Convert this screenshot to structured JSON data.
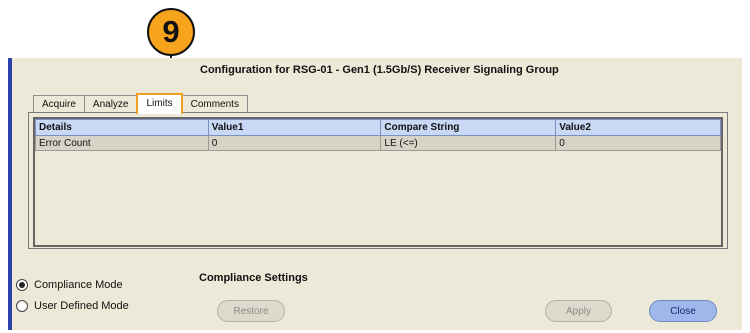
{
  "callout": {
    "number": "9"
  },
  "window": {
    "title": "Configuration for RSG-01 - Gen1 (1.5Gb/S) Receiver Signaling Group"
  },
  "tabs": [
    {
      "label": "Acquire",
      "active": false
    },
    {
      "label": "Analyze",
      "active": false
    },
    {
      "label": "Limits",
      "active": true
    },
    {
      "label": "Comments",
      "active": false
    }
  ],
  "table": {
    "columns": [
      "Details",
      "Value1",
      "Compare String",
      "Value2"
    ],
    "rows": [
      [
        "Error Count",
        "0",
        "LE (<=)",
        "0"
      ]
    ]
  },
  "modes": {
    "compliance": {
      "label": "Compliance Mode",
      "selected": true
    },
    "user_defined": {
      "label": "User Defined Mode",
      "selected": false
    }
  },
  "settings": {
    "title": "Compliance Settings"
  },
  "buttons": {
    "restore": "Restore",
    "apply": "Apply",
    "close": "Close"
  },
  "colors": {
    "accent": "#2b43a9",
    "callout": "#f5a41c",
    "header": "#c9d8f4"
  }
}
